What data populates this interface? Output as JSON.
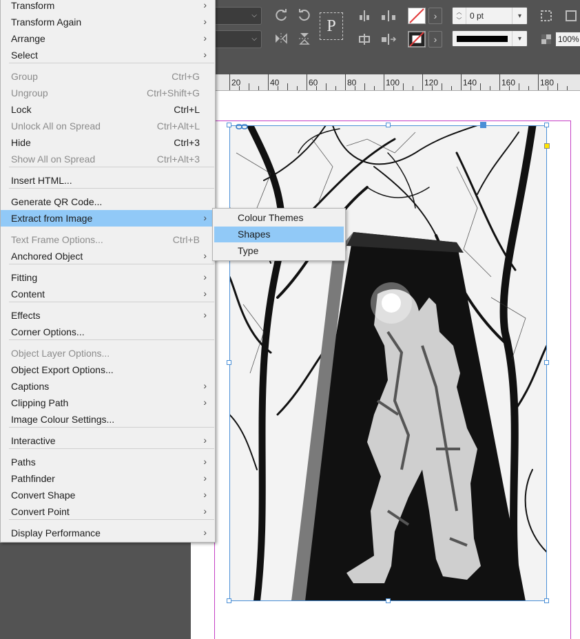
{
  "toolbar": {
    "stroke_weight": "0 pt",
    "zoom_percent": "100%",
    "paragraph_symbol": "P"
  },
  "ruler": {
    "labels": [
      "20",
      "40",
      "60",
      "80",
      "100",
      "120",
      "140",
      "160",
      "180"
    ]
  },
  "context_menu": {
    "items": [
      {
        "label": "Transform",
        "shortcut": "",
        "submenu": true,
        "disabled": false
      },
      {
        "label": "Transform Again",
        "shortcut": "",
        "submenu": true,
        "disabled": false
      },
      {
        "label": "Arrange",
        "shortcut": "",
        "submenu": true,
        "disabled": false
      },
      {
        "label": "Select",
        "shortcut": "",
        "submenu": true,
        "disabled": false
      },
      {
        "label": "Group",
        "shortcut": "Ctrl+G",
        "submenu": false,
        "disabled": true
      },
      {
        "label": "Ungroup",
        "shortcut": "Ctrl+Shift+G",
        "submenu": false,
        "disabled": true
      },
      {
        "label": "Lock",
        "shortcut": "Ctrl+L",
        "submenu": false,
        "disabled": false
      },
      {
        "label": "Unlock All on Spread",
        "shortcut": "Ctrl+Alt+L",
        "submenu": false,
        "disabled": true
      },
      {
        "label": "Hide",
        "shortcut": "Ctrl+3",
        "submenu": false,
        "disabled": false
      },
      {
        "label": "Show All on Spread",
        "shortcut": "Ctrl+Alt+3",
        "submenu": false,
        "disabled": true
      },
      {
        "label": "Insert HTML...",
        "shortcut": "",
        "submenu": false,
        "disabled": false
      },
      {
        "label": "Generate QR Code...",
        "shortcut": "",
        "submenu": false,
        "disabled": false
      },
      {
        "label": "Extract from Image",
        "shortcut": "",
        "submenu": true,
        "disabled": false,
        "highlighted": true
      },
      {
        "label": "Text Frame Options...",
        "shortcut": "Ctrl+B",
        "submenu": false,
        "disabled": true
      },
      {
        "label": "Anchored Object",
        "shortcut": "",
        "submenu": true,
        "disabled": false
      },
      {
        "label": "Fitting",
        "shortcut": "",
        "submenu": true,
        "disabled": false
      },
      {
        "label": "Content",
        "shortcut": "",
        "submenu": true,
        "disabled": false
      },
      {
        "label": "Effects",
        "shortcut": "",
        "submenu": true,
        "disabled": false
      },
      {
        "label": "Corner Options...",
        "shortcut": "",
        "submenu": false,
        "disabled": false
      },
      {
        "label": "Object Layer Options...",
        "shortcut": "",
        "submenu": false,
        "disabled": true
      },
      {
        "label": "Object Export Options...",
        "shortcut": "",
        "submenu": false,
        "disabled": false
      },
      {
        "label": "Captions",
        "shortcut": "",
        "submenu": true,
        "disabled": false
      },
      {
        "label": "Clipping Path",
        "shortcut": "",
        "submenu": true,
        "disabled": false
      },
      {
        "label": "Image Colour Settings...",
        "shortcut": "",
        "submenu": false,
        "disabled": false
      },
      {
        "label": "Interactive",
        "shortcut": "",
        "submenu": true,
        "disabled": false
      },
      {
        "label": "Paths",
        "shortcut": "",
        "submenu": true,
        "disabled": false
      },
      {
        "label": "Pathfinder",
        "shortcut": "",
        "submenu": true,
        "disabled": false
      },
      {
        "label": "Convert Shape",
        "shortcut": "",
        "submenu": true,
        "disabled": false
      },
      {
        "label": "Convert Point",
        "shortcut": "",
        "submenu": true,
        "disabled": false
      },
      {
        "label": "Display Performance",
        "shortcut": "",
        "submenu": true,
        "disabled": false
      }
    ]
  },
  "submenu": {
    "items": [
      {
        "label": "Colour Themes",
        "highlighted": false
      },
      {
        "label": "Shapes",
        "highlighted": true
      },
      {
        "label": "Type",
        "highlighted": false
      }
    ]
  },
  "colors": {
    "menu_highlight": "#91c9f7",
    "frame_selection": "#4a8fd6",
    "page_border": "#c43fc4"
  }
}
